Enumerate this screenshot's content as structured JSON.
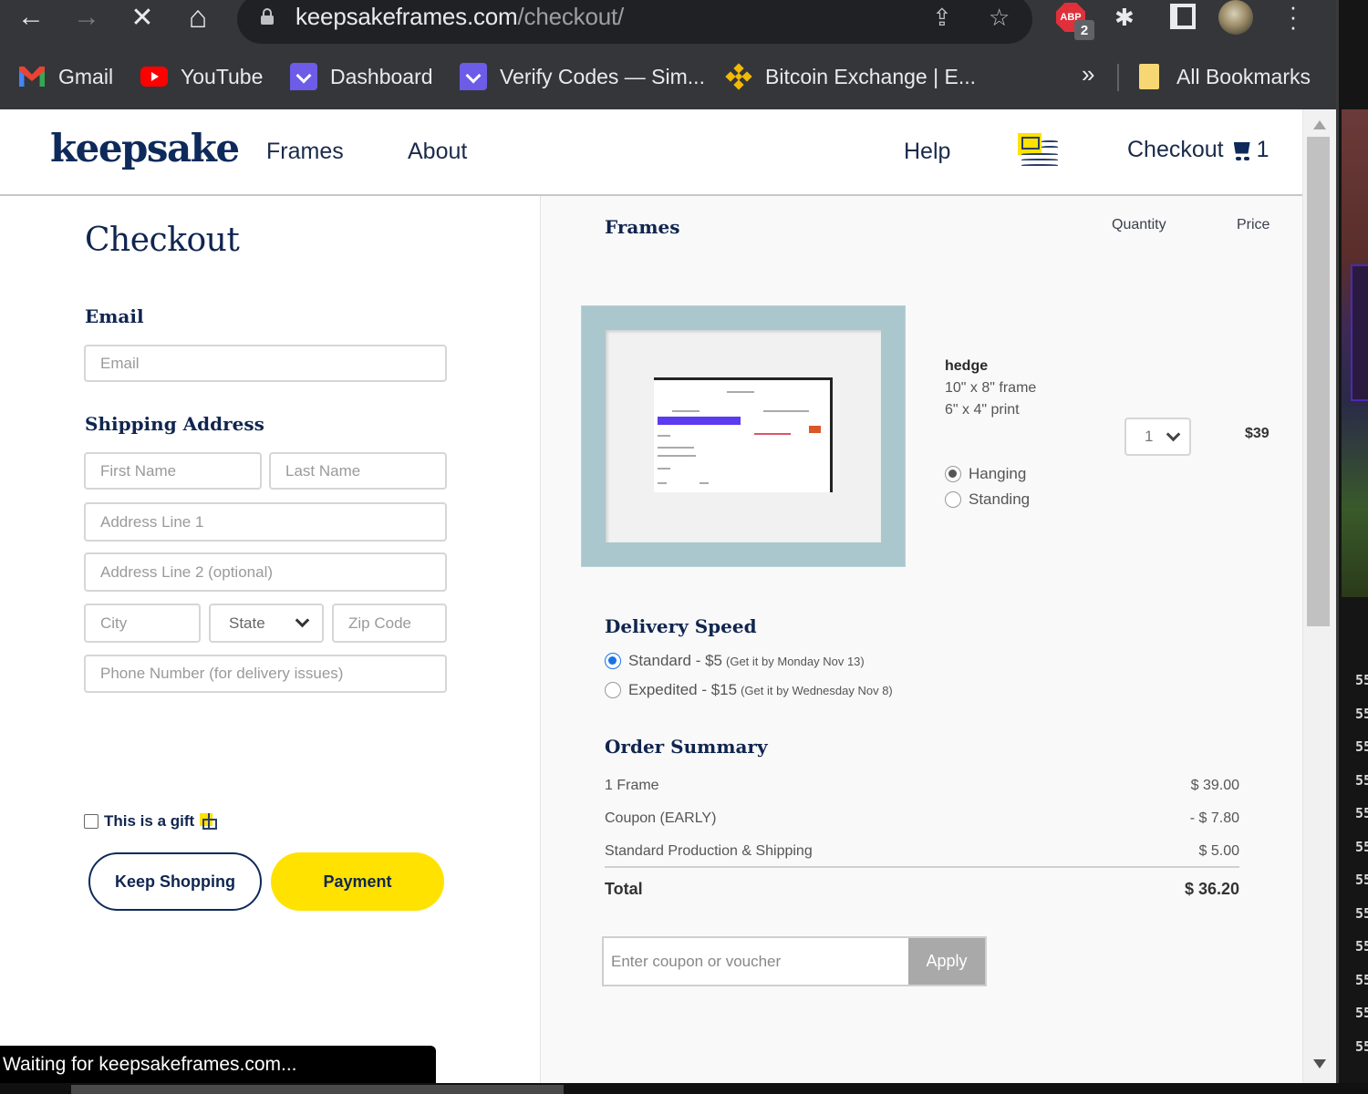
{
  "browser": {
    "url_host": "keepsakeframes.com",
    "url_path": "/checkout/",
    "nav": {
      "back": "←",
      "forward": "→",
      "stop": "✕",
      "home": "⌂"
    },
    "extensions": {
      "abp_label": "ABP",
      "abp_badge": "2"
    },
    "bookmarks": [
      {
        "label": "Gmail",
        "icon": "gmail-icon"
      },
      {
        "label": "YouTube",
        "icon": "youtube-icon"
      },
      {
        "label": "Dashboard",
        "icon": "purple-chat-icon"
      },
      {
        "label": "Verify Codes — Sim...",
        "icon": "purple-chat-icon"
      },
      {
        "label": "Bitcoin Exchange | E...",
        "icon": "binance-icon"
      }
    ],
    "bookmarks_more": "»",
    "all_bookmarks": "All Bookmarks",
    "status_text": "Waiting for keepsakeframes.com..."
  },
  "site": {
    "logo": "keepsake",
    "nav": {
      "frames": "Frames",
      "about": "About",
      "help": "Help",
      "checkout": "Checkout",
      "cart_count": "1"
    }
  },
  "checkout": {
    "title": "Checkout",
    "email_heading": "Email",
    "email_placeholder": "Email",
    "shipping_heading": "Shipping Address",
    "first_name_placeholder": "First Name",
    "last_name_placeholder": "Last Name",
    "address1_placeholder": "Address Line 1",
    "address2_placeholder": "Address Line 2 (optional)",
    "city_placeholder": "City",
    "state_selected": "State",
    "zip_placeholder": "Zip Code",
    "phone_placeholder": "Phone Number (for delivery issues)",
    "gift_label": "This is a gift",
    "gift_checked": false,
    "keep_shopping": "Keep Shopping",
    "payment": "Payment"
  },
  "cart": {
    "heading": "Frames",
    "col_quantity": "Quantity",
    "col_price": "Price",
    "item": {
      "name": "hedge",
      "frame_size": "10\" x 8\" frame",
      "print_size": "6\" x 4\" print",
      "mount_options": [
        {
          "label": "Hanging",
          "selected": true
        },
        {
          "label": "Standing",
          "selected": false
        }
      ],
      "quantity": "1",
      "price": "$39"
    }
  },
  "delivery": {
    "heading": "Delivery Speed",
    "options": [
      {
        "label": "Standard - $5",
        "note": "(Get it by Monday Nov 13)",
        "selected": true
      },
      {
        "label": "Expedited - $15",
        "note": "(Get it by Wednesday Nov 8)",
        "selected": false
      }
    ]
  },
  "summary": {
    "heading": "Order Summary",
    "rows": [
      {
        "label": "1 Frame",
        "value": "$ 39.00"
      },
      {
        "label": "Coupon (EARLY)",
        "value": "- $ 7.80"
      },
      {
        "label": "Standard Production & Shipping",
        "value": "$ 5.00"
      }
    ],
    "total_label": "Total",
    "total_value": "$ 36.20",
    "coupon_placeholder": "Enter coupon or voucher",
    "apply": "Apply"
  },
  "colors": {
    "brand_navy": "#0e2a5a",
    "accent_yellow": "#ffe200",
    "radio_blue": "#1a73e8"
  },
  "side_window": {
    "code_fragment": "55"
  }
}
